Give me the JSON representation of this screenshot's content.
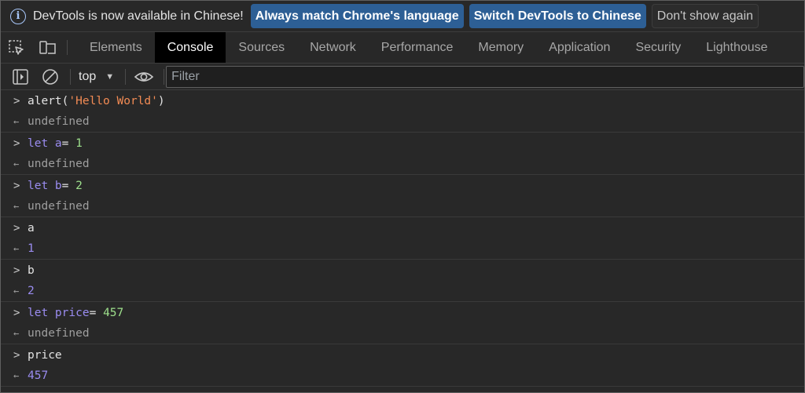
{
  "infobar": {
    "message": "DevTools is now available in Chinese!",
    "btn_match": "Always match Chrome's language",
    "btn_switch": "Switch DevTools to Chinese",
    "btn_dismiss": "Don't show again"
  },
  "tabs": [
    "Elements",
    "Console",
    "Sources",
    "Network",
    "Performance",
    "Memory",
    "Application",
    "Security",
    "Lighthouse"
  ],
  "active_tab": "Console",
  "console_toolbar": {
    "context": "top",
    "filter_placeholder": "Filter"
  },
  "console": {
    "lines": [
      {
        "kind": "in",
        "parts": [
          {
            "t": "alert(",
            "c": "plain"
          },
          {
            "t": "'Hello World'",
            "c": "str"
          },
          {
            "t": ")",
            "c": "plain"
          }
        ]
      },
      {
        "kind": "out",
        "parts": [
          {
            "t": "undefined",
            "c": "undef"
          }
        ]
      },
      {
        "kind": "in",
        "parts": [
          {
            "t": "let",
            "c": "kw"
          },
          {
            "t": " a",
            "c": "kw"
          },
          {
            "t": "= ",
            "c": "plain"
          },
          {
            "t": "1",
            "c": "num"
          }
        ]
      },
      {
        "kind": "out",
        "parts": [
          {
            "t": "undefined",
            "c": "undef"
          }
        ]
      },
      {
        "kind": "in",
        "parts": [
          {
            "t": "let",
            "c": "kw"
          },
          {
            "t": " b",
            "c": "kw"
          },
          {
            "t": "= ",
            "c": "plain"
          },
          {
            "t": "2",
            "c": "num"
          }
        ]
      },
      {
        "kind": "out",
        "parts": [
          {
            "t": "undefined",
            "c": "undef"
          }
        ]
      },
      {
        "kind": "in",
        "parts": [
          {
            "t": "a",
            "c": "plain"
          }
        ]
      },
      {
        "kind": "out",
        "parts": [
          {
            "t": "1",
            "c": "numout"
          }
        ]
      },
      {
        "kind": "in",
        "parts": [
          {
            "t": "b",
            "c": "plain"
          }
        ]
      },
      {
        "kind": "out",
        "parts": [
          {
            "t": "2",
            "c": "numout"
          }
        ]
      },
      {
        "kind": "in",
        "parts": [
          {
            "t": "let",
            "c": "kw"
          },
          {
            "t": " price",
            "c": "kw"
          },
          {
            "t": "= ",
            "c": "plain"
          },
          {
            "t": "457",
            "c": "num"
          }
        ]
      },
      {
        "kind": "out",
        "parts": [
          {
            "t": "undefined",
            "c": "undef"
          }
        ]
      },
      {
        "kind": "in",
        "parts": [
          {
            "t": "price",
            "c": "plain"
          }
        ]
      },
      {
        "kind": "out",
        "parts": [
          {
            "t": "457",
            "c": "numout"
          }
        ]
      }
    ]
  },
  "icons": {
    "info": "info-icon",
    "inspect": "inspect-element-icon",
    "device": "device-toolbar-icon",
    "sidebar": "console-sidebar-icon",
    "clear": "clear-console-icon",
    "eye": "live-expression-eye-icon"
  }
}
